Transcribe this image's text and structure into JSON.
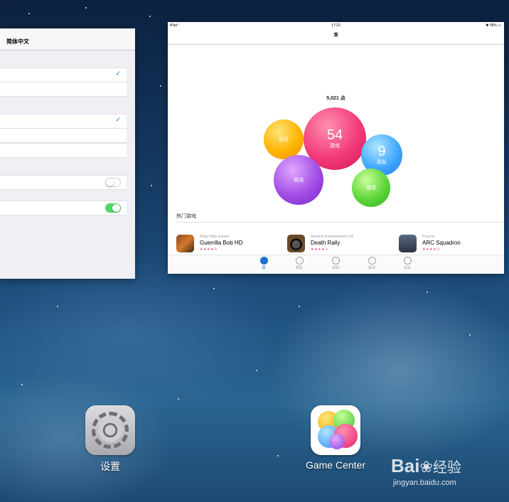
{
  "settings_panel": {
    "nav_title": "简体中文",
    "rows": [
      {
        "type": "check"
      },
      {
        "type": "plain"
      },
      {
        "type": "check"
      },
      {
        "type": "plain"
      },
      {
        "type": "plain"
      },
      {
        "type": "toggle",
        "state": "off"
      },
      {
        "type": "toggle",
        "state": "on"
      }
    ]
  },
  "game_center_panel": {
    "status_bar": {
      "device": "iPad",
      "time": "17:22",
      "battery": "95%"
    },
    "nav_title": "我",
    "points": "5,021 点",
    "bubbles": {
      "turns": {
        "label": "回合"
      },
      "games": {
        "number": "54",
        "label": "游戏"
      },
      "friends": {
        "number": "9",
        "label": "朋友"
      },
      "challenges": {
        "label": "挑战"
      },
      "invite": {
        "label": "邀请"
      }
    },
    "popular_games_title": "热门游戏",
    "popular_games": [
      {
        "developer": "Angry Mob Games",
        "name": "Guerrilla Bob HD",
        "stars": "★★★★½"
      },
      {
        "developer": "Remedy Entertainment Ltd.",
        "name": "Death Rally",
        "stars": "★★★★½"
      },
      {
        "developer": "Psyonix",
        "name": "ARC Squadron",
        "stars": "★★★★½"
      }
    ],
    "tab_bar": [
      {
        "label": "我",
        "icon": "person-icon",
        "active": true
      },
      {
        "label": "朋友",
        "icon": "friends-icon",
        "active": false
      },
      {
        "label": "游戏",
        "icon": "games-icon",
        "active": false
      },
      {
        "label": "挑战",
        "icon": "challenges-icon",
        "active": false
      },
      {
        "label": "回合",
        "icon": "turns-icon",
        "active": false
      }
    ]
  },
  "home_screen": {
    "apps": [
      {
        "label": "设置",
        "icon": "settings-gear-icon"
      },
      {
        "label": "Game Center",
        "icon": "game-center-bubbles-icon"
      }
    ]
  },
  "watermark": {
    "brand": "Bai",
    "brand_suffix": "经验",
    "url": "jingyan.baidu.com"
  },
  "colors": {
    "ios_blue": "#007aff",
    "toggle_on": "#4cd964",
    "rating_pink": "#e84d8a",
    "tab_active": "#1f6fd0"
  }
}
